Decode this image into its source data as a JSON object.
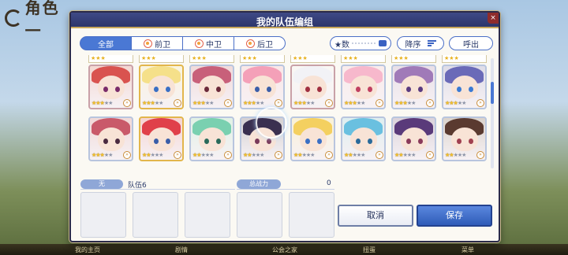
{
  "background": {
    "title": "角色一",
    "bottom_menu": [
      "我的主页",
      "剧情",
      "公会之家",
      "扭蛋",
      "菜单"
    ]
  },
  "modal": {
    "title": "我的队伍编组",
    "close_label": "×"
  },
  "filters": {
    "tabs": [
      {
        "label": "全部",
        "active": true,
        "icon": ""
      },
      {
        "label": "前卫",
        "active": false,
        "icon": "position-front-icon"
      },
      {
        "label": "中卫",
        "active": false,
        "icon": "position-middle-icon"
      },
      {
        "label": "后卫",
        "active": false,
        "icon": "position-back-icon"
      }
    ],
    "sort_label": "★数",
    "order_label": "降序",
    "callout_label": "呼出"
  },
  "characters": {
    "row1": [
      {
        "hair": "#d9534f",
        "eye": "#7a2c6a",
        "frame": "red",
        "stars": 3
      },
      {
        "hair": "#f5e08a",
        "eye": "#3a6fc4",
        "frame": "gold",
        "stars": 3
      },
      {
        "hair": "#c8607a",
        "eye": "#6b2a3a",
        "frame": "silver",
        "stars": 3
      },
      {
        "hair": "#f4a0b8",
        "eye": "#3b5ea8",
        "frame": "silver",
        "stars": 3
      },
      {
        "hair": "#f2f2f6",
        "eye": "#a03040",
        "frame": "red",
        "stars": 3
      },
      {
        "hair": "#f7b8cc",
        "eye": "#c04060",
        "frame": "silver",
        "stars": 3
      },
      {
        "hair": "#a07ab8",
        "eye": "#5a3a80",
        "frame": "silver",
        "stars": 3
      },
      {
        "hair": "#6a6ab8",
        "eye": "#3a7ad4",
        "frame": "silver",
        "stars": 3
      }
    ],
    "row2": [
      {
        "hair": "#c95a6a",
        "eye": "#4a2a40",
        "frame": "silver",
        "stars": 3
      },
      {
        "hair": "#e0404a",
        "eye": "#3a5ea8",
        "frame": "gold",
        "stars": 2
      },
      {
        "hair": "#7ad0b0",
        "eye": "#2a6a5a",
        "frame": "silver",
        "stars": 2
      },
      {
        "hair": "#3a3050",
        "eye": "#7a3a5a",
        "frame": "silver",
        "stars": 2
      },
      {
        "hair": "#f4d060",
        "eye": "#3a6fc4",
        "frame": "silver",
        "stars": 2
      },
      {
        "hair": "#6ac0e0",
        "eye": "#2a6a9a",
        "frame": "silver",
        "stars": 2
      },
      {
        "hair": "#5a3a7a",
        "eye": "#8a3a5a",
        "frame": "silver",
        "stars": 2
      },
      {
        "hair": "#5a3a30",
        "eye": "#a04050",
        "frame": "silver",
        "stars": 2
      }
    ]
  },
  "team": {
    "label": "无",
    "name": "队伍6",
    "power_label": "总战力",
    "power_value": "0"
  },
  "actions": {
    "cancel": "取消",
    "save": "保存"
  }
}
